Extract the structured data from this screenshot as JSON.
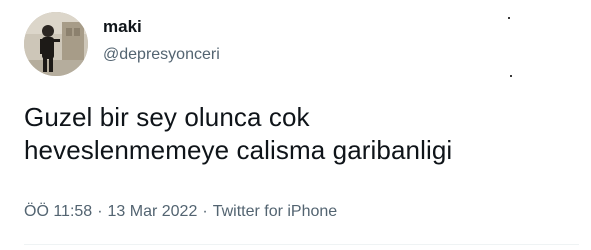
{
  "tweet": {
    "display_name": "maki",
    "handle": "@depresyonceri",
    "text": "Guzel bir sey olunca cok\nheveslenmemeye calisma garibanligi",
    "time": "ÖÖ 11:58",
    "date": "13 Mar 2022",
    "separator": "·",
    "source": "Twitter for iPhone",
    "avatar_icon": "profile-photo-person-icon"
  },
  "colors": {
    "text_primary": "#0f1419",
    "text_secondary": "#536471",
    "background": "#ffffff",
    "divider": "#eff3f4"
  }
}
